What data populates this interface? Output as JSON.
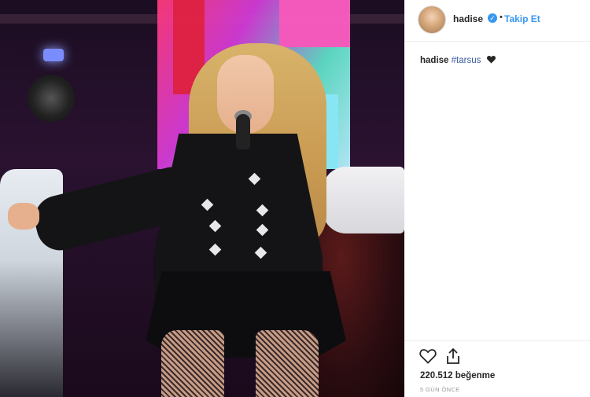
{
  "post": {
    "username": "hadise",
    "verified_mark": "✓",
    "separator": "•",
    "follow_label": "Takip Et",
    "caption_user": "hadise",
    "caption_hashtag": "#tarsus",
    "caption_emoji": "black-heart-icon",
    "likes_text": "220.512 beğenme",
    "time_text": "5 GÜN ÖNCE"
  },
  "colors": {
    "accent": "#3897f0",
    "hashtag": "#3a5c9e",
    "text": "#262626",
    "muted": "#999999"
  }
}
